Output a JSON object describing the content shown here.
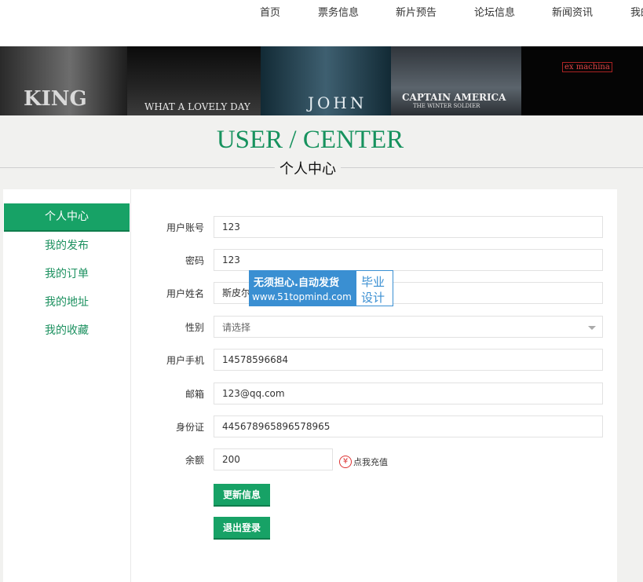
{
  "nav": {
    "items": [
      {
        "label": "首页"
      },
      {
        "label": "票务信息"
      },
      {
        "label": "新片预告"
      },
      {
        "label": "论坛信息"
      },
      {
        "label": "新闻资讯"
      },
      {
        "label": "我的"
      }
    ]
  },
  "banner": {
    "posters": [
      {
        "text": "KING"
      },
      {
        "text": "WHAT A LOVELY DAY"
      },
      {
        "text": "JOHN"
      },
      {
        "text": "CAPTAIN AMERICA"
      },
      {
        "text": "THE WINTER SOLDIER"
      },
      {
        "text": "ex machina"
      }
    ]
  },
  "heading": {
    "title_en": "USER / CENTER",
    "title_cn": "个人中心"
  },
  "sidebar": {
    "items": [
      {
        "label": "个人中心",
        "active": true
      },
      {
        "label": "我的发布"
      },
      {
        "label": "我的订单"
      },
      {
        "label": "我的地址"
      },
      {
        "label": "我的收藏"
      }
    ]
  },
  "form": {
    "account": {
      "label": "用户账号",
      "value": "123"
    },
    "password": {
      "label": "密码",
      "value": "123"
    },
    "name": {
      "label": "用户姓名",
      "value": "斯皮尔伯格"
    },
    "gender": {
      "label": "性别",
      "value": "请选择"
    },
    "phone": {
      "label": "用户手机",
      "value": "14578596684"
    },
    "email": {
      "label": "邮箱",
      "value": "123@qq.com"
    },
    "idcard": {
      "label": "身份证",
      "value": "445678965896578965"
    },
    "balance": {
      "label": "余额",
      "value": "200",
      "recharge_icon": "¥",
      "recharge_label": "点我充值"
    },
    "update_button": "更新信息",
    "logout_button": "退出登录"
  },
  "watermark": {
    "line1": "无须担心.自动发货",
    "line2": "www.51topmind.com",
    "side1": "毕业",
    "side2": "设计"
  },
  "colors": {
    "accent": "#17a266",
    "title": "#17925e",
    "watermark": "#3a8fd2"
  }
}
